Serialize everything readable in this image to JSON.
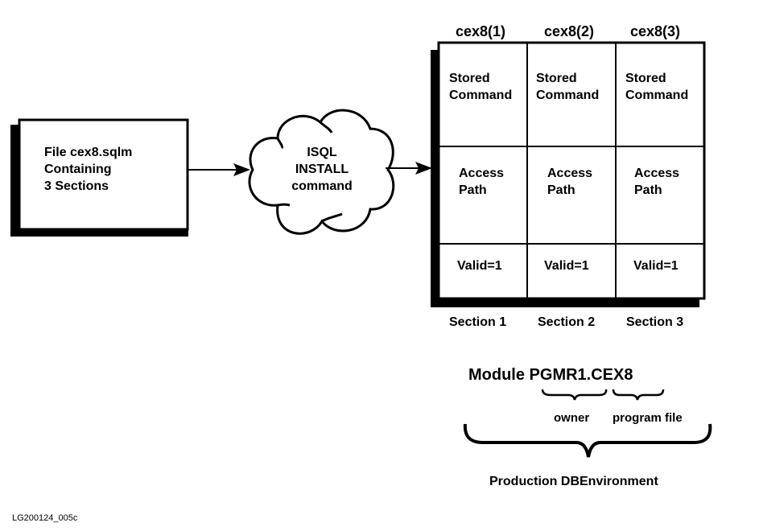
{
  "file_box": {
    "lines": [
      "File cex8.sqlm",
      "Containing",
      "3 Sections"
    ]
  },
  "cloud": {
    "lines": [
      "ISQL",
      "INSTALL",
      "command"
    ]
  },
  "module_grid": {
    "columns": [
      {
        "header": "cex8(1)",
        "stored": [
          "Stored",
          "Command"
        ],
        "access": [
          "Access",
          "Path"
        ],
        "valid": "Valid=1",
        "footer": "Section 1"
      },
      {
        "header": "cex8(2)",
        "stored": [
          "Stored",
          "Command"
        ],
        "access": [
          "Access",
          "Path"
        ],
        "valid": "Valid=1",
        "footer": "Section 2"
      },
      {
        "header": "cex8(3)",
        "stored": [
          "Stored",
          "Command"
        ],
        "access": [
          "Access",
          "Path"
        ],
        "valid": "Valid=1",
        "footer": "Section 3"
      }
    ]
  },
  "module_name": {
    "label": "Module PGMR1.CEX8",
    "owner_label": "owner",
    "program_label": "program file",
    "environment_label": "Production DBEnvironment"
  },
  "figure_id": "LG200124_005c"
}
